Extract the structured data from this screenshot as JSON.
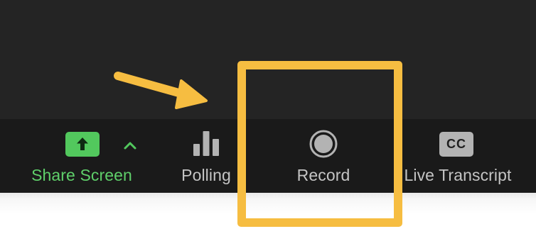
{
  "toolbar": {
    "share_screen": {
      "label": "Share Screen",
      "icon": "share-screen-up-arrow-icon",
      "color": "#52c85d"
    },
    "share_options": {
      "icon": "chevron-up-icon"
    },
    "polling": {
      "label": "Polling",
      "icon": "bar-chart-icon"
    },
    "record": {
      "label": "Record",
      "icon": "record-icon"
    },
    "live_transcript": {
      "label": "Live Transcript",
      "icon": "closed-caption-icon",
      "icon_text": "CC"
    }
  },
  "annotation": {
    "highlight_color": "#f6bd41",
    "arrow_icon": "pointing-arrow-icon"
  }
}
